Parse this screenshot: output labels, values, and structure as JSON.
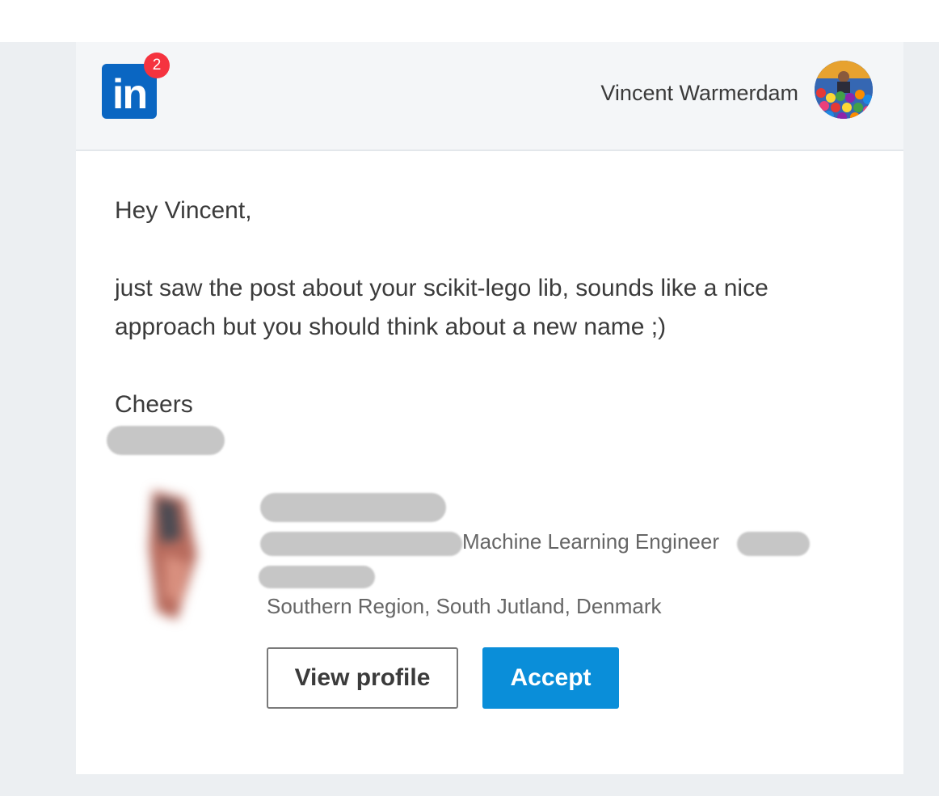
{
  "header": {
    "logo_text": "in",
    "notification_count": "2",
    "user_name": "Vincent Warmerdam"
  },
  "message": {
    "greeting": "Hey Vincent,",
    "body": "just saw the post about your scikit-lego lib, sounds like a nice approach but you should think about a new name ;)",
    "signoff": "Cheers"
  },
  "contact": {
    "headline": "Machine Learning Engineer",
    "location": "Southern Region, South Jutland, Denmark"
  },
  "actions": {
    "view_profile_label": "View profile",
    "accept_label": "Accept"
  },
  "colors": {
    "brand": "#0a66c2",
    "accept_button": "#0a8ed9",
    "badge": "#f5333f"
  }
}
